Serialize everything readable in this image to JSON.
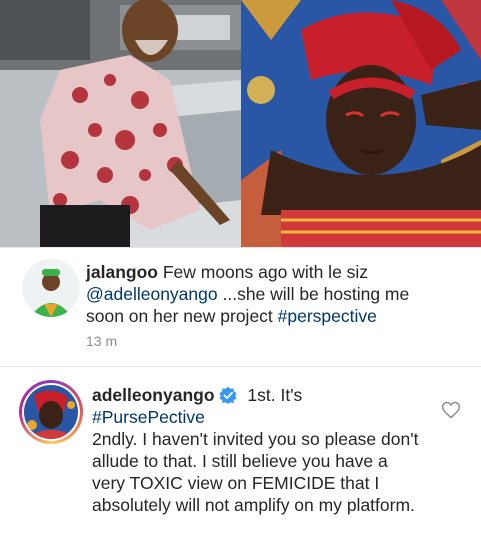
{
  "comments": [
    {
      "username": "jalangoo",
      "text_parts": [
        "Few moons ago with le siz ",
        "@adelleonyango",
        " ...she will be hosting me soon on her new project ",
        "#perspective"
      ],
      "time": "13 m"
    },
    {
      "username": "adelleonyango",
      "verified": true,
      "line1_after": "1st. It's",
      "hashtag": "#PursePective",
      "body": "2ndly. I haven't invited you so please don't allude to that. I still believe you have a very TOXIC view on FEMICIDE that I absolutely will not amplify on my platform."
    }
  ],
  "icons": {
    "verified": "verified-badge-icon",
    "like": "heart-icon"
  },
  "colors": {
    "link": "#00376b",
    "verified": "#3897f0",
    "meta": "#8e8e8e"
  }
}
